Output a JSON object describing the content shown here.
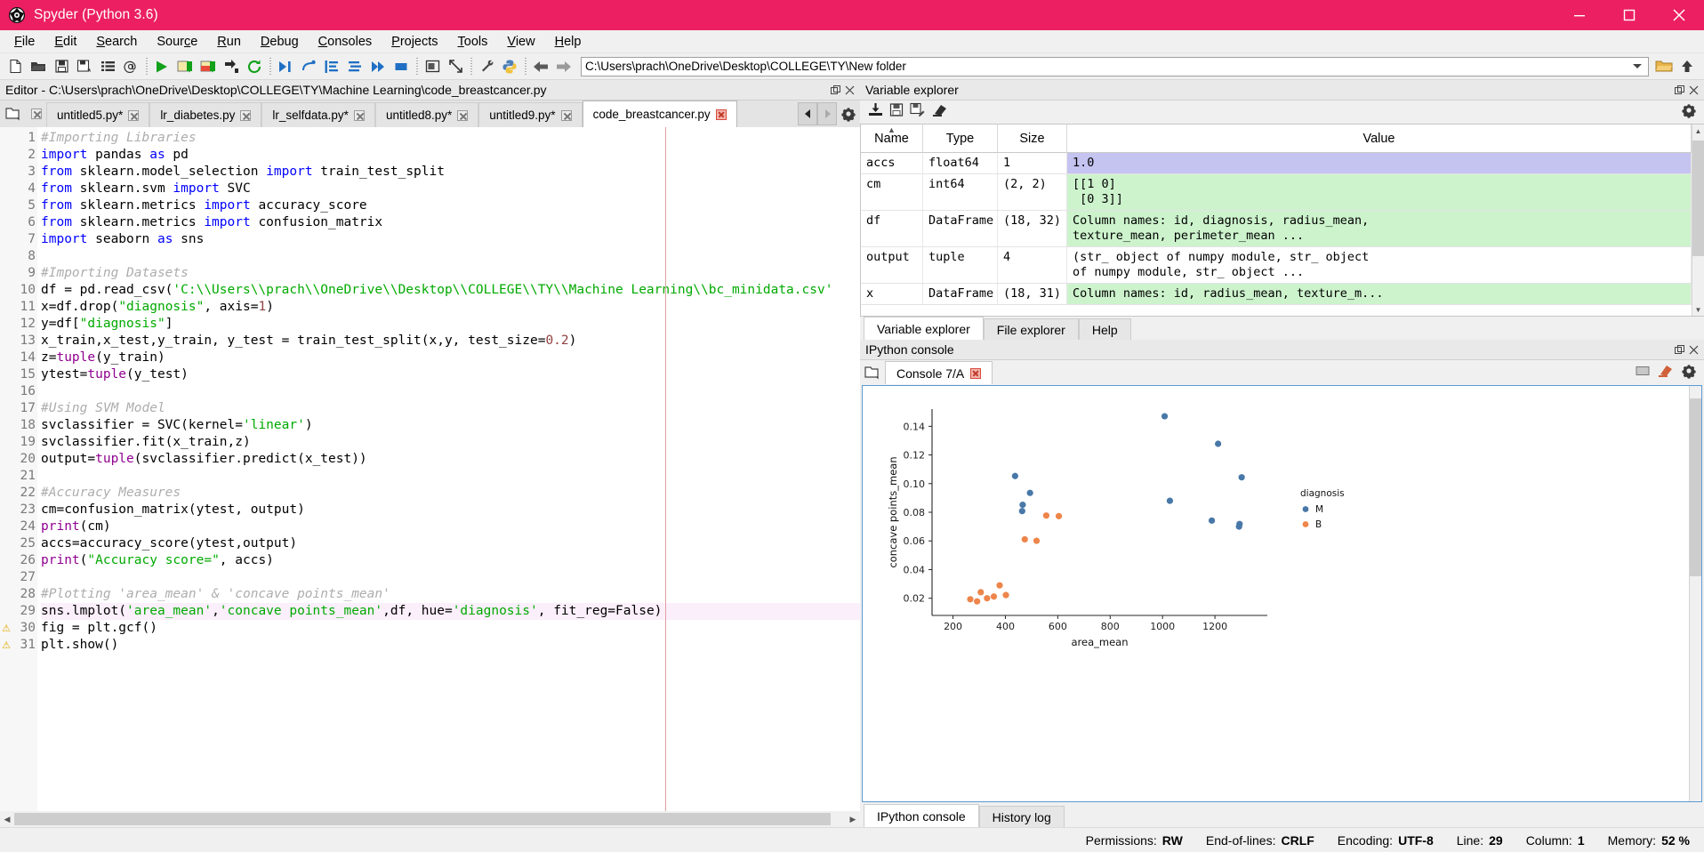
{
  "titlebar": {
    "title": "Spyder (Python 3.6)",
    "accent_color": "#ec1f63",
    "minimize": "minimize-icon",
    "maximize": "maximize-icon",
    "close": "close-icon"
  },
  "menubar": {
    "items": [
      {
        "label": "File",
        "mnemonic": "F"
      },
      {
        "label": "Edit",
        "mnemonic": "E"
      },
      {
        "label": "Search",
        "mnemonic": "S"
      },
      {
        "label": "Source",
        "mnemonic": "c"
      },
      {
        "label": "Run",
        "mnemonic": "R"
      },
      {
        "label": "Debug",
        "mnemonic": "D"
      },
      {
        "label": "Consoles",
        "mnemonic": "C"
      },
      {
        "label": "Projects",
        "mnemonic": "P"
      },
      {
        "label": "Tools",
        "mnemonic": "T"
      },
      {
        "label": "View",
        "mnemonic": "V"
      },
      {
        "label": "Help",
        "mnemonic": "H"
      }
    ]
  },
  "toolbar": {
    "path_value": "C:\\Users\\prach\\OneDrive\\Desktop\\COLLEGE\\TY\\New folder"
  },
  "editor": {
    "header_title": "Editor - C:\\Users\\prach\\OneDrive\\Desktop\\COLLEGE\\TY\\Machine Learning\\code_breastcancer.py",
    "tabs": [
      {
        "label": "untitled5.py*",
        "active": false
      },
      {
        "label": "lr_diabetes.py",
        "active": false
      },
      {
        "label": "lr_selfdata.py*",
        "active": false
      },
      {
        "label": "untitled8.py*",
        "active": false
      },
      {
        "label": "untitled9.py*",
        "active": false
      },
      {
        "label": "code_breastcancer.py",
        "active": true
      }
    ],
    "lines": [
      {
        "n": 1,
        "warn": false,
        "hl": false,
        "tokens": [
          {
            "t": "#Importing Libraries",
            "c": "cm"
          }
        ]
      },
      {
        "n": 2,
        "warn": false,
        "hl": false,
        "tokens": [
          {
            "t": "import",
            "c": "kw"
          },
          {
            "t": " pandas ",
            "c": ""
          },
          {
            "t": "as",
            "c": "kw"
          },
          {
            "t": " pd",
            "c": ""
          }
        ]
      },
      {
        "n": 3,
        "warn": false,
        "hl": false,
        "tokens": [
          {
            "t": "from",
            "c": "kw"
          },
          {
            "t": " sklearn.model_selection ",
            "c": ""
          },
          {
            "t": "import",
            "c": "kw"
          },
          {
            "t": " train_test_split",
            "c": ""
          }
        ]
      },
      {
        "n": 4,
        "warn": false,
        "hl": false,
        "tokens": [
          {
            "t": "from",
            "c": "kw"
          },
          {
            "t": " sklearn.svm ",
            "c": ""
          },
          {
            "t": "import",
            "c": "kw"
          },
          {
            "t": " SVC",
            "c": ""
          }
        ]
      },
      {
        "n": 5,
        "warn": false,
        "hl": false,
        "tokens": [
          {
            "t": "from",
            "c": "kw"
          },
          {
            "t": " sklearn.metrics ",
            "c": ""
          },
          {
            "t": "import",
            "c": "kw"
          },
          {
            "t": " accuracy_score",
            "c": ""
          }
        ]
      },
      {
        "n": 6,
        "warn": false,
        "hl": false,
        "tokens": [
          {
            "t": "from",
            "c": "kw"
          },
          {
            "t": " sklearn.metrics ",
            "c": ""
          },
          {
            "t": "import",
            "c": "kw"
          },
          {
            "t": " confusion_matrix",
            "c": ""
          }
        ]
      },
      {
        "n": 7,
        "warn": false,
        "hl": false,
        "tokens": [
          {
            "t": "import",
            "c": "kw"
          },
          {
            "t": " seaborn ",
            "c": ""
          },
          {
            "t": "as",
            "c": "kw"
          },
          {
            "t": " sns",
            "c": ""
          }
        ]
      },
      {
        "n": 8,
        "warn": false,
        "hl": false,
        "tokens": []
      },
      {
        "n": 9,
        "warn": false,
        "hl": false,
        "tokens": [
          {
            "t": "#Importing Datasets",
            "c": "cm"
          }
        ]
      },
      {
        "n": 10,
        "warn": false,
        "hl": false,
        "tokens": [
          {
            "t": "df = pd.read_csv(",
            "c": ""
          },
          {
            "t": "'C:\\\\Users\\\\prach\\\\OneDrive\\\\Desktop\\\\COLLEGE\\\\TY\\\\Machine Learning\\\\bc_minidata.csv'",
            "c": "st"
          }
        ]
      },
      {
        "n": 11,
        "warn": false,
        "hl": false,
        "tokens": [
          {
            "t": "x=df.drop(",
            "c": ""
          },
          {
            "t": "\"diagnosis\"",
            "c": "st"
          },
          {
            "t": ", axis=",
            "c": ""
          },
          {
            "t": "1",
            "c": "nm"
          },
          {
            "t": ")",
            "c": ""
          }
        ]
      },
      {
        "n": 12,
        "warn": false,
        "hl": false,
        "tokens": [
          {
            "t": "y=df[",
            "c": ""
          },
          {
            "t": "\"diagnosis\"",
            "c": "st"
          },
          {
            "t": "]",
            "c": ""
          }
        ]
      },
      {
        "n": 13,
        "warn": false,
        "hl": false,
        "tokens": [
          {
            "t": "x_train,x_test,y_train, y_test = train_test_split(x,y, test_size=",
            "c": ""
          },
          {
            "t": "0.2",
            "c": "nm"
          },
          {
            "t": ")",
            "c": ""
          }
        ]
      },
      {
        "n": 14,
        "warn": false,
        "hl": false,
        "tokens": [
          {
            "t": "z=",
            "c": ""
          },
          {
            "t": "tuple",
            "c": "bi"
          },
          {
            "t": "(y_train)",
            "c": ""
          }
        ]
      },
      {
        "n": 15,
        "warn": false,
        "hl": false,
        "tokens": [
          {
            "t": "ytest=",
            "c": ""
          },
          {
            "t": "tuple",
            "c": "bi"
          },
          {
            "t": "(y_test)",
            "c": ""
          }
        ]
      },
      {
        "n": 16,
        "warn": false,
        "hl": false,
        "tokens": []
      },
      {
        "n": 17,
        "warn": false,
        "hl": false,
        "tokens": [
          {
            "t": "#Using SVM Model",
            "c": "cm"
          }
        ]
      },
      {
        "n": 18,
        "warn": false,
        "hl": false,
        "tokens": [
          {
            "t": "svclassifier = SVC(kernel=",
            "c": ""
          },
          {
            "t": "'linear'",
            "c": "st"
          },
          {
            "t": ")",
            "c": ""
          }
        ]
      },
      {
        "n": 19,
        "warn": false,
        "hl": false,
        "tokens": [
          {
            "t": "svclassifier.fit(x_train,z)",
            "c": ""
          }
        ]
      },
      {
        "n": 20,
        "warn": false,
        "hl": false,
        "tokens": [
          {
            "t": "output=",
            "c": ""
          },
          {
            "t": "tuple",
            "c": "bi"
          },
          {
            "t": "(svclassifier.predict(x_test))",
            "c": ""
          }
        ]
      },
      {
        "n": 21,
        "warn": false,
        "hl": false,
        "tokens": []
      },
      {
        "n": 22,
        "warn": false,
        "hl": false,
        "tokens": [
          {
            "t": "#Accuracy Measures",
            "c": "cm"
          }
        ]
      },
      {
        "n": 23,
        "warn": false,
        "hl": false,
        "tokens": [
          {
            "t": "cm=confusion_matrix(ytest, output)",
            "c": ""
          }
        ]
      },
      {
        "n": 24,
        "warn": false,
        "hl": false,
        "tokens": [
          {
            "t": "print",
            "c": "bi"
          },
          {
            "t": "(cm)",
            "c": ""
          }
        ]
      },
      {
        "n": 25,
        "warn": false,
        "hl": false,
        "tokens": [
          {
            "t": "accs=accuracy_score(ytest,output)",
            "c": ""
          }
        ]
      },
      {
        "n": 26,
        "warn": false,
        "hl": false,
        "tokens": [
          {
            "t": "print",
            "c": "bi"
          },
          {
            "t": "(",
            "c": ""
          },
          {
            "t": "\"Accuracy score=\"",
            "c": "st"
          },
          {
            "t": ", accs)",
            "c": ""
          }
        ]
      },
      {
        "n": 27,
        "warn": false,
        "hl": false,
        "tokens": []
      },
      {
        "n": 28,
        "warn": false,
        "hl": false,
        "tokens": [
          {
            "t": "#Plotting 'area_mean' & 'concave points_mean'",
            "c": "cm"
          }
        ]
      },
      {
        "n": 29,
        "warn": false,
        "hl": true,
        "tokens": [
          {
            "t": "sns.lmplot(",
            "c": ""
          },
          {
            "t": "'area_mean'",
            "c": "st"
          },
          {
            "t": ",",
            "c": ""
          },
          {
            "t": "'concave points_mean'",
            "c": "st"
          },
          {
            "t": ",df, hue=",
            "c": ""
          },
          {
            "t": "'diagnosis'",
            "c": "st"
          },
          {
            "t": ", fit_reg=False)",
            "c": ""
          }
        ]
      },
      {
        "n": 30,
        "warn": true,
        "hl": false,
        "tokens": [
          {
            "t": "fig = plt.gcf()",
            "c": ""
          }
        ]
      },
      {
        "n": 31,
        "warn": true,
        "hl": false,
        "tokens": [
          {
            "t": "plt.show()",
            "c": ""
          }
        ]
      }
    ]
  },
  "variable_explorer": {
    "header_title": "Variable explorer",
    "columns": [
      "Name",
      "Type",
      "Size",
      "Value"
    ],
    "rows": [
      {
        "name": "accs",
        "type": "float64",
        "size": "1",
        "value": "1.0",
        "highlight": "purple"
      },
      {
        "name": "cm",
        "type": "int64",
        "size": "(2, 2)",
        "value": "[[1 0]\n [0 3]]",
        "highlight": "green"
      },
      {
        "name": "df",
        "type": "DataFrame",
        "size": "(18, 32)",
        "value": "Column names: id, diagnosis, radius_mean,\ntexture_mean, perimeter_mean ...",
        "highlight": "green"
      },
      {
        "name": "output",
        "type": "tuple",
        "size": "4",
        "value": "(str_ object of numpy module, str_ object\nof numpy module, str_ object ...",
        "highlight": "none"
      },
      {
        "name": "x",
        "type": "DataFrame",
        "size": "(18, 31)",
        "value": "Column names: id, radius_mean, texture_m...",
        "highlight": "green"
      }
    ],
    "tabs": [
      {
        "label": "Variable explorer",
        "active": true
      },
      {
        "label": "File explorer",
        "active": false
      },
      {
        "label": "Help",
        "active": false
      }
    ]
  },
  "ipython": {
    "header_title": "IPython console",
    "console_tab": "Console 7/A",
    "tabs": [
      {
        "label": "IPython console",
        "active": true
      },
      {
        "label": "History log",
        "active": false
      }
    ]
  },
  "chart_data": {
    "type": "scatter",
    "title": "",
    "xlabel": "area_mean",
    "ylabel": "concave points_mean",
    "xlim": [
      120,
      1400
    ],
    "ylim": [
      0.008,
      0.152
    ],
    "xticks": [
      200,
      400,
      600,
      800,
      1000,
      1200
    ],
    "yticks": [
      0.02,
      0.04,
      0.06,
      0.08,
      0.1,
      0.12,
      0.14
    ],
    "legend_title": "diagnosis",
    "legend_position": "right",
    "grid": false,
    "series": [
      {
        "name": "M",
        "color": "#4878a8",
        "points": [
          [
            1008,
            0.147
          ],
          [
            1212,
            0.1278
          ],
          [
            437,
            0.1053
          ],
          [
            1302,
            0.1044
          ],
          [
            494,
            0.0935
          ],
          [
            1028,
            0.088
          ],
          [
            466,
            0.0852
          ],
          [
            464,
            0.0808
          ],
          [
            1292,
            0.07
          ],
          [
            1188,
            0.0742
          ],
          [
            1294,
            0.0718
          ]
        ]
      },
      {
        "name": "B",
        "color": "#ee854a",
        "points": [
          [
            556,
            0.0777
          ],
          [
            604,
            0.0773
          ],
          [
            474,
            0.0611
          ],
          [
            519,
            0.0601
          ],
          [
            378,
            0.029
          ],
          [
            306,
            0.0242
          ],
          [
            356,
            0.0212
          ],
          [
            330,
            0.02
          ],
          [
            266,
            0.0193
          ],
          [
            402,
            0.0222
          ],
          [
            292,
            0.0178
          ]
        ]
      }
    ]
  },
  "statusbar": {
    "items": [
      {
        "label": "Permissions:",
        "value": "RW"
      },
      {
        "label": "End-of-lines:",
        "value": "CRLF"
      },
      {
        "label": "Encoding:",
        "value": "UTF-8"
      },
      {
        "label": "Line:",
        "value": "29"
      },
      {
        "label": "Column:",
        "value": "1"
      },
      {
        "label": "Memory:",
        "value": "52 %"
      }
    ]
  }
}
